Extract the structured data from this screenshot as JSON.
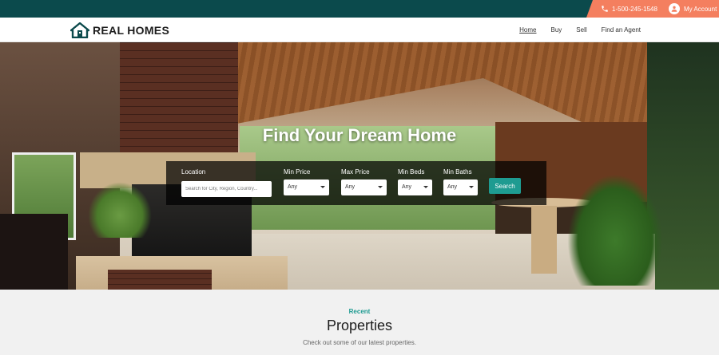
{
  "topbar": {
    "phone": "1-500-245-1548",
    "account": "My Account",
    "colors": {
      "bar": "#0b4a4c",
      "accent": "#f47f5f"
    },
    "icons": {
      "phone": "phone-icon",
      "account": "user-circle-icon"
    }
  },
  "header": {
    "logo_text": "REAL HOMES",
    "logo_icon": "house-icon",
    "nav": [
      "Home",
      "Buy",
      "Sell",
      "Find an Agent"
    ],
    "active_nav": "Home"
  },
  "hero": {
    "title": "Find Your Dream Home",
    "search": {
      "location_label": "Location",
      "location_placeholder": "Search for City, Region, Country...",
      "min_price_label": "Min Price",
      "min_price_value": "Any",
      "max_price_label": "Max Price",
      "max_price_value": "Any",
      "min_beds_label": "Min Beds",
      "min_beds_value": "Any",
      "min_baths_label": "Min Baths",
      "min_baths_value": "Any",
      "button": "Search",
      "button_color": "#1e9b91"
    }
  },
  "section": {
    "subtitle": "Recent",
    "title": "Properties",
    "description": "Check out some of our latest properties."
  }
}
